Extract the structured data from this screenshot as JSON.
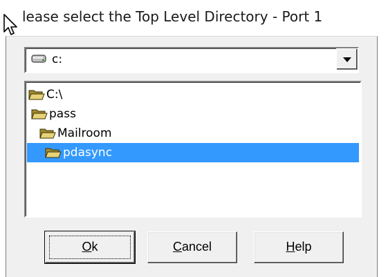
{
  "window": {
    "title": "lease select the Top Level Directory - Port 1"
  },
  "drive_select": {
    "value": "c:",
    "icon": "drive-icon"
  },
  "directories": [
    {
      "label": "C:\\",
      "icon": "folder-open-icon",
      "selected": false
    },
    {
      "label": "pass",
      "icon": "folder-open-icon",
      "selected": false
    },
    {
      "label": "Mailroom",
      "icon": "folder-open-icon",
      "selected": false
    },
    {
      "label": "pdasync",
      "icon": "folder-open-icon",
      "selected": true
    }
  ],
  "buttons": {
    "ok": {
      "mnemonic": "O",
      "rest": "k"
    },
    "cancel": {
      "mnemonic": "C",
      "rest": "ancel"
    },
    "help": {
      "mnemonic": "H",
      "rest": "elp"
    }
  },
  "colors": {
    "selection": "#3399ff",
    "dialog_bg": "#f0f0f0"
  }
}
